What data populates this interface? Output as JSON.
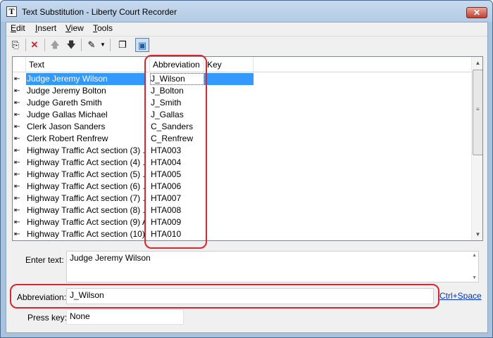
{
  "window": {
    "title": "Text Substitution - Liberty Court Recorder",
    "app_icon_glyph": "T",
    "close_glyph": "✕"
  },
  "menu": [
    {
      "label": "Edit",
      "accel": "E",
      "rest": "dit"
    },
    {
      "label": "Insert",
      "accel": "I",
      "rest": "nsert"
    },
    {
      "label": "View",
      "accel": "V",
      "rest": "iew"
    },
    {
      "label": "Tools",
      "accel": "T",
      "rest": "ools"
    }
  ],
  "toolbar": {
    "icons": [
      "new-entry-icon",
      "delete-icon",
      "move-up-icon",
      "move-down-icon",
      "edit-pen-icon",
      "dropdown-arrow-icon",
      "copy-icon",
      "toggle-view-icon"
    ],
    "glyphs": {
      "new": "⎘",
      "delete": "✕",
      "up": "🡅",
      "down": "🡇",
      "pen": "✎",
      "dropdown": "▼",
      "copy": "❐",
      "view": "▣"
    }
  },
  "table": {
    "columns": [
      "Text",
      "Abbreviation",
      "Key"
    ],
    "row_marker": "⇤",
    "rows": [
      {
        "text": "Judge Jeremy Wilson",
        "abbr": "J_Wilson",
        "key": "",
        "selected": true
      },
      {
        "text": "Judge Jeremy Bolton",
        "abbr": "J_Bolton",
        "key": ""
      },
      {
        "text": "Judge Gareth Smith",
        "abbr": "J_Smith",
        "key": ""
      },
      {
        "text": "Judge Gallas Michael",
        "abbr": "J_Gallas",
        "key": ""
      },
      {
        "text": "Clerk Jason Sanders",
        "abbr": "C_Sanders",
        "key": ""
      },
      {
        "text": "Clerk Robert Renfrew",
        "abbr": "C_Renfrew",
        "key": ""
      },
      {
        "text": "Highway Traffic Act section (3)  ...",
        "abbr": "HTA003",
        "key": ""
      },
      {
        "text": "Highway Traffic Act section (4)  ...",
        "abbr": "HTA004",
        "key": ""
      },
      {
        "text": "Highway Traffic Act section (5)  ...",
        "abbr": "HTA005",
        "key": ""
      },
      {
        "text": "Highway Traffic Act section (6)  ...",
        "abbr": "HTA006",
        "key": ""
      },
      {
        "text": "Highway Traffic Act section (7)  ...",
        "abbr": "HTA007",
        "key": ""
      },
      {
        "text": "Highway Traffic Act section (8)  ...",
        "abbr": "HTA008",
        "key": ""
      },
      {
        "text": "Highway Traffic Act section (9) A...",
        "abbr": "HTA009",
        "key": ""
      },
      {
        "text": "Highway Traffic Act section (10) ...",
        "abbr": "HTA010",
        "key": ""
      }
    ]
  },
  "scrollbar": {
    "up_glyph": "▲",
    "down_glyph": "▼",
    "grip_glyph": "≡"
  },
  "form": {
    "enter_text_label": "Enter text:",
    "enter_text_value": "Judge Jeremy Wilson",
    "abbreviation_label": "Abbreviation:",
    "abbreviation_value": "J_Wilson",
    "shortcut_link": "Ctrl+Space",
    "press_key_label": "Press key:",
    "press_key_value": "None"
  },
  "colors": {
    "selection": "#3399ff",
    "callout": "#d9262f",
    "link": "#0033cc"
  }
}
